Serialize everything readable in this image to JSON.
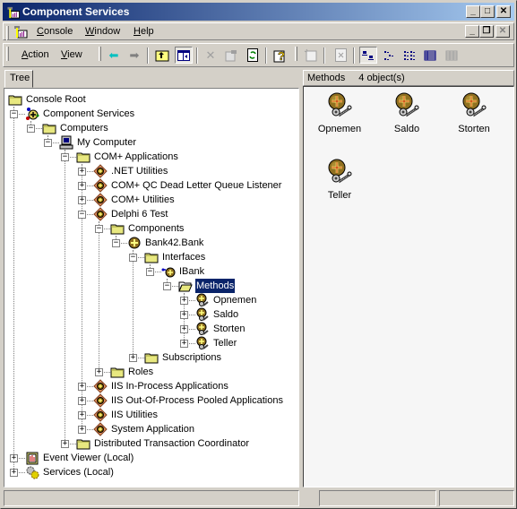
{
  "window": {
    "title": "Component Services"
  },
  "menubar": {
    "items": [
      {
        "label": "Console",
        "accel": "C"
      },
      {
        "label": "Window",
        "accel": "W"
      },
      {
        "label": "Help",
        "accel": "H"
      }
    ]
  },
  "toolbar": {
    "action_label": "Action",
    "view_label": "View",
    "buttons": [
      "back",
      "forward",
      "up-one-level",
      "show-hide-console-tree",
      "delete",
      "properties",
      "refresh",
      "help",
      "new-window",
      "export-list",
      "large-icons",
      "small-icons",
      "list",
      "detail",
      "customize"
    ]
  },
  "left_tab": "Tree",
  "right_header": {
    "title": "Methods",
    "count": "4 object(s)"
  },
  "tree": [
    {
      "label": "Console Root",
      "level": 0,
      "exp": "",
      "icon": "folder"
    },
    {
      "label": "Component Services",
      "level": 1,
      "exp": "-",
      "icon": "component-services"
    },
    {
      "label": "Computers",
      "level": 2,
      "exp": "-",
      "icon": "folder"
    },
    {
      "label": "My Computer",
      "level": 3,
      "exp": "-",
      "icon": "computer"
    },
    {
      "label": "COM+ Applications",
      "level": 4,
      "exp": "-",
      "icon": "folder"
    },
    {
      "label": ".NET Utilities",
      "level": 5,
      "exp": "+",
      "icon": "app"
    },
    {
      "label": "COM+ QC Dead Letter Queue Listener",
      "level": 5,
      "exp": "+",
      "icon": "app"
    },
    {
      "label": "COM+ Utilities",
      "level": 5,
      "exp": "+",
      "icon": "app"
    },
    {
      "label": "Delphi 6 Test",
      "level": 5,
      "exp": "-",
      "icon": "app"
    },
    {
      "label": "Components",
      "level": 6,
      "exp": "-",
      "icon": "folder"
    },
    {
      "label": "Bank42.Bank",
      "level": 7,
      "exp": "-",
      "icon": "component"
    },
    {
      "label": "Interfaces",
      "level": 8,
      "exp": "-",
      "icon": "folder"
    },
    {
      "label": "IBank",
      "level": 9,
      "exp": "-",
      "icon": "interface"
    },
    {
      "label": "Methods",
      "level": 10,
      "exp": "-",
      "icon": "folder-open",
      "selected": true
    },
    {
      "label": "Opnemen",
      "level": 11,
      "exp": "+",
      "icon": "method"
    },
    {
      "label": "Saldo",
      "level": 11,
      "exp": "+",
      "icon": "method"
    },
    {
      "label": "Storten",
      "level": 11,
      "exp": "+",
      "icon": "method"
    },
    {
      "label": "Teller",
      "level": 11,
      "exp": "+",
      "icon": "method"
    },
    {
      "label": "Subscriptions",
      "level": 8,
      "exp": "+",
      "icon": "folder"
    },
    {
      "label": "Roles",
      "level": 6,
      "exp": "+",
      "icon": "folder"
    },
    {
      "label": "IIS In-Process Applications",
      "level": 5,
      "exp": "+",
      "icon": "app"
    },
    {
      "label": "IIS Out-Of-Process Pooled Applications",
      "level": 5,
      "exp": "+",
      "icon": "app"
    },
    {
      "label": "IIS Utilities",
      "level": 5,
      "exp": "+",
      "icon": "app"
    },
    {
      "label": "System Application",
      "level": 5,
      "exp": "+",
      "icon": "app"
    },
    {
      "label": "Distributed Transaction Coordinator",
      "level": 4,
      "exp": "+",
      "icon": "folder"
    },
    {
      "label": "Event Viewer (Local)",
      "level": 1,
      "exp": "+",
      "icon": "event-viewer"
    },
    {
      "label": "Services (Local)",
      "level": 1,
      "exp": "+",
      "icon": "services"
    }
  ],
  "list_items": [
    {
      "label": "Opnemen"
    },
    {
      "label": "Saldo"
    },
    {
      "label": "Storten"
    },
    {
      "label": "Teller"
    }
  ],
  "colors": {
    "title_start": "#0a246a",
    "title_end": "#a6caf0",
    "selection": "#0a246a"
  }
}
